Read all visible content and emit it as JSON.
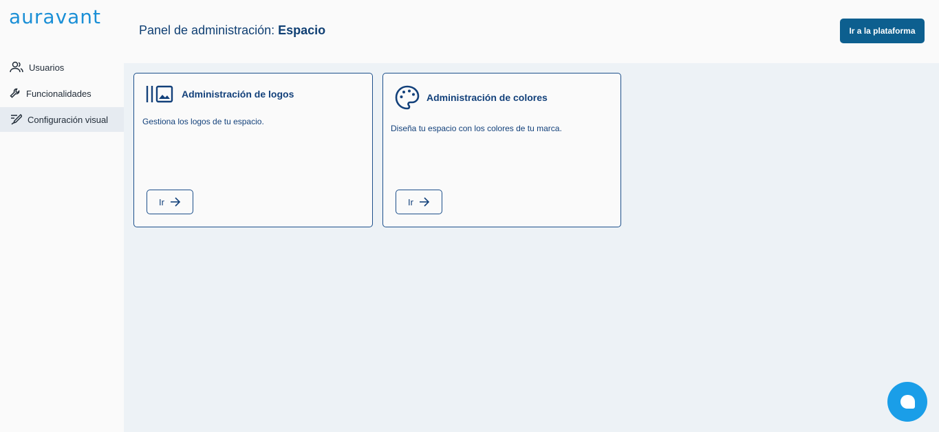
{
  "brand": {
    "logo_text": "auravant",
    "logo_color": "#1a8fd6"
  },
  "sidebar": {
    "items": [
      {
        "label": "Usuarios",
        "icon": "users-icon",
        "active": false
      },
      {
        "label": "Funcionalidades",
        "icon": "wrench-icon",
        "active": false
      },
      {
        "label": "Configuración visual",
        "icon": "paint-brush-icon",
        "active": true
      }
    ]
  },
  "header": {
    "title_prefix": "Panel de administración: ",
    "title_space": "Espacio",
    "platform_button": "Ir a la plataforma"
  },
  "cards": [
    {
      "title": "Administración de logos",
      "description": "Gestiona los logos de tu espacio.",
      "button_label": "Ir",
      "icon": "image-gallery-icon"
    },
    {
      "title": "Administración de colores",
      "description": "Diseña tu espacio con los colores de tu marca.",
      "button_label": "Ir",
      "icon": "palette-icon"
    }
  ],
  "chat": {
    "icon": "chat-icon"
  },
  "colors": {
    "primary": "#0d5f8f",
    "text_dark_blue": "#12407a",
    "content_bg": "#edf2f6",
    "chat": "#1a9ee8"
  }
}
